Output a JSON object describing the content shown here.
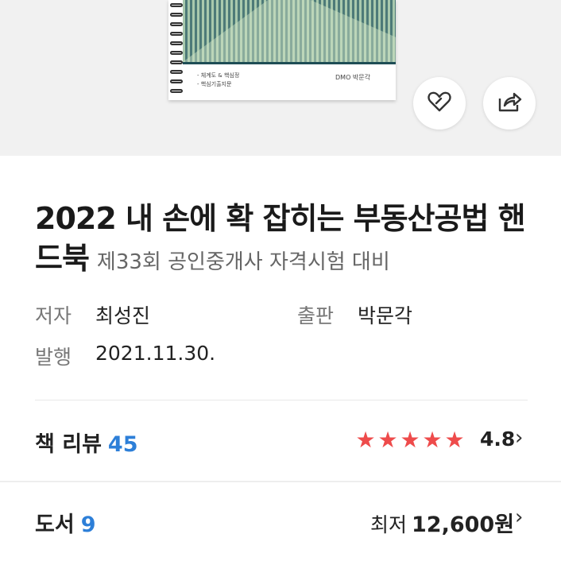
{
  "hero": {
    "cover_lines": [
      "- 체계도 & 핵심정",
      "- 핵심기출지문"
    ],
    "cover_publisher": "DMO 박문각",
    "like_icon": "heart-icon",
    "share_icon": "share-icon"
  },
  "book": {
    "title_main": "2022 내 손에 확 잡히는 부동산공법 핸드북",
    "title_sub": "제33회 공인중개사 자격시험 대비",
    "author_label": "저자",
    "author": "최성진",
    "publisher_label": "출판",
    "publisher": "박문각",
    "date_label": "발행",
    "date": "2021.11.30."
  },
  "reviews": {
    "label": "책 리뷰",
    "count": "45",
    "rating": "4.8",
    "rating_value": 4.8,
    "max_stars": 5,
    "star_color": "#ee4b4b"
  },
  "books": {
    "label": "도서",
    "count": "9",
    "price_prefix": "최저",
    "price": "12,600원"
  },
  "colors": {
    "accent": "#2d7fd8",
    "background_hero": "#f1f1f1"
  }
}
